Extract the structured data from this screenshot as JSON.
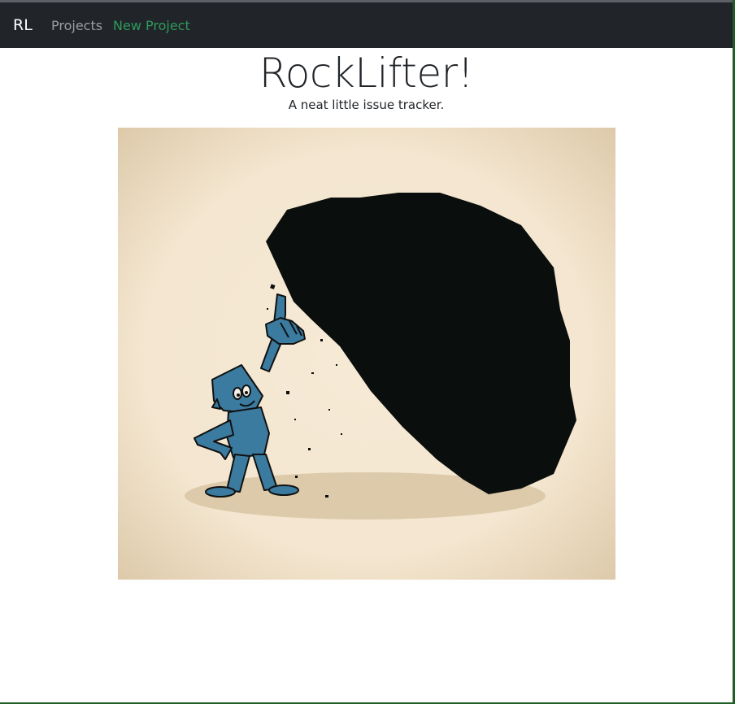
{
  "navbar": {
    "brand": "RL",
    "links": [
      {
        "label": "Projects",
        "active": false
      },
      {
        "label": "New Project",
        "active": true
      }
    ],
    "colors": {
      "background": "#212529",
      "link": "#a6a8aa",
      "active_link": "#2e9a5c"
    }
  },
  "hero": {
    "title": "RockLifter!",
    "subtitle": "A neat little issue tracker.",
    "image": {
      "icon": "man-lifting-boulder-illustration",
      "colors": {
        "background": "#f4e6d0",
        "vignette": "#dcc8a8",
        "rock": "#0a0e0d",
        "figure": "#3b7ba0",
        "shadow": "#dccaaa"
      }
    }
  }
}
